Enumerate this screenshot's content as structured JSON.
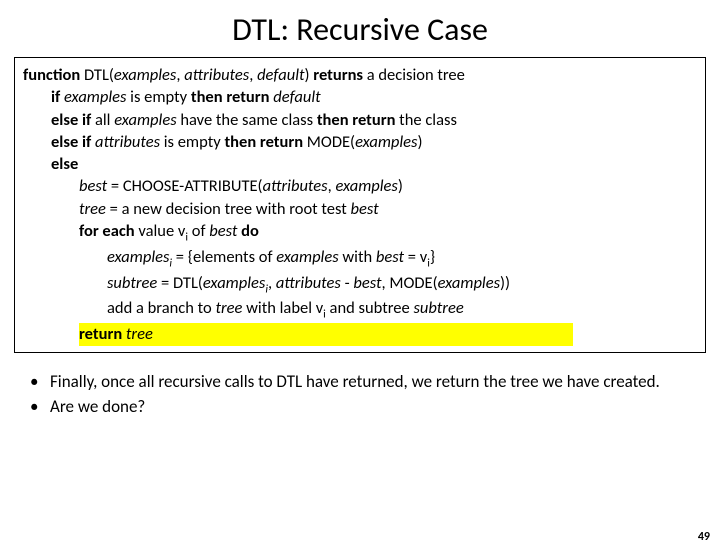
{
  "title": "DTL: Recursive Case",
  "code": {
    "l0a": "function",
    "l0b": " DTL(",
    "l0c": "examples",
    "l0d": ", ",
    "l0e": "attributes",
    "l0f": ", ",
    "l0g": "default",
    "l0h": ") ",
    "l0i": "returns",
    "l0j": " a decision tree",
    "l1a": "if",
    "l1b": " ",
    "l1c": "examples",
    "l1d": " is empty ",
    "l1e": "then return",
    "l1f": " ",
    "l1g": "default",
    "l2a": "else if",
    "l2b": " all ",
    "l2c": "examples",
    "l2d": " have the same class ",
    "l2e": "then return",
    "l2f": " the class",
    "l3a": "else if",
    "l3b": " ",
    "l3c": "attributes",
    "l3d": " is empty ",
    "l3e": "then return",
    "l3f": " MODE(",
    "l3g": "examples",
    "l3h": ")",
    "l4a": "else",
    "l5a": "best",
    "l5b": " = CHOOSE-ATTRIBUTE(",
    "l5c": "attributes",
    "l5d": ", ",
    "l5e": "examples",
    "l5f": ")",
    "l6a": "tree",
    "l6b": " = a new decision tree with root test ",
    "l6c": "best",
    "l7a": "for each",
    "l7b": " value v",
    "l7c": "i",
    "l7d": " of ",
    "l7e": "best",
    "l7f": " ",
    "l7g": "do",
    "l8a": "examples",
    "l8b": "i",
    "l8c": " = {elements of ",
    "l8d": "examples",
    "l8e": " with ",
    "l8f": "best",
    "l8g": " = v",
    "l8h": "i",
    "l8i": "}",
    "l9a": "subtree",
    "l9b": " = DTL(",
    "l9c": "examples",
    "l9d": "i",
    "l9e": ", ",
    "l9f": "attributes",
    "l9g": " - ",
    "l9h": "best",
    "l9i": ", MODE(",
    "l9j": "examples",
    "l9k": "))",
    "l10a": "add a branch to ",
    "l10b": "tree",
    "l10c": " with label v",
    "l10d": "i",
    "l10e": " and subtree ",
    "l10f": "subtree",
    "l11a": "return",
    "l11b": " ",
    "l11c": "tree"
  },
  "bullets": {
    "b1": "Finally, once all recursive calls to DTL have returned, we return the tree we have created.",
    "b2": "Are we done?"
  },
  "page": "49"
}
